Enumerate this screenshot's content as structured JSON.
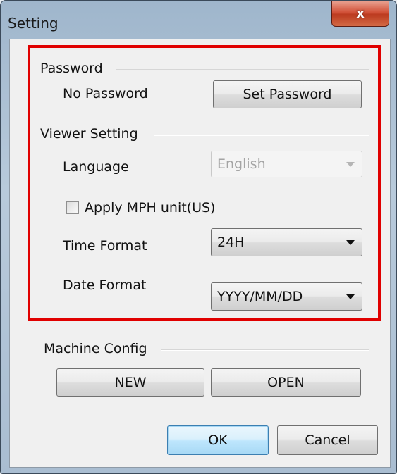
{
  "window": {
    "title": "Setting",
    "close_label": "x"
  },
  "password": {
    "section_label": "Password",
    "status_label": "No Password",
    "set_button": "Set Password"
  },
  "viewer": {
    "section_label": "Viewer Setting",
    "language_label": "Language",
    "language_value": "English",
    "language_enabled": false,
    "mph_label": "Apply MPH unit(US)",
    "mph_checked": false,
    "time_format_label": "Time Format",
    "time_format_value": "24H",
    "date_format_label": "Date Format",
    "date_format_value": "YYYY/MM/DD"
  },
  "machine": {
    "section_label": "Machine Config",
    "new_button": "NEW",
    "open_button": "OPEN"
  },
  "footer": {
    "ok_button": "OK",
    "cancel_button": "Cancel"
  },
  "colors": {
    "highlight_border": "#e00000",
    "close_button": "#c8432a",
    "default_button": "#3c7fb1"
  }
}
